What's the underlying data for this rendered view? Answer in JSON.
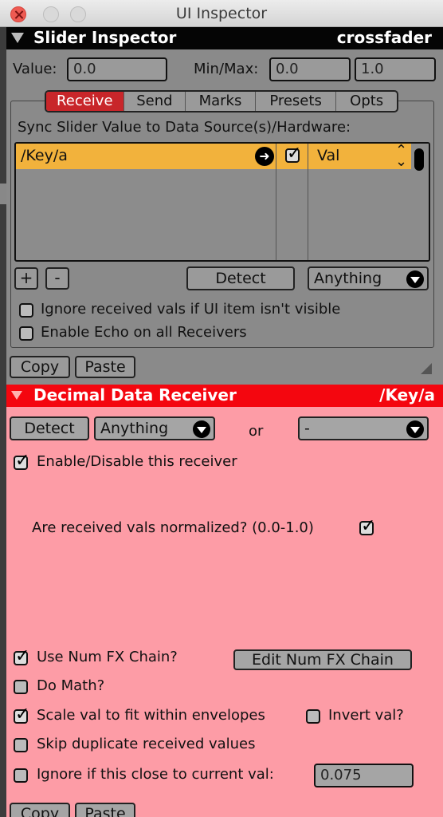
{
  "window": {
    "title": "UI Inspector"
  },
  "slider_inspector": {
    "title": "Slider Inspector",
    "item_name": "crossfader",
    "value_label": "Value:",
    "value": "0.0",
    "minmax_label": "Min/Max:",
    "min": "0.0",
    "max": "1.0",
    "tabs": [
      {
        "label": "Receive",
        "active": true
      },
      {
        "label": "Send"
      },
      {
        "label": "Marks"
      },
      {
        "label": "Presets"
      },
      {
        "label": "Opts"
      }
    ],
    "sync_label": "Sync Slider Value to Data Source(s)/Hardware:",
    "receivers": [
      {
        "address": "/Key/a",
        "enabled": true,
        "mode": "Val"
      }
    ],
    "add_label": "+",
    "remove_label": "-",
    "detect_label": "Detect",
    "type_dropdown": "Anything",
    "ignore_invisible": {
      "label": "Ignore received vals if UI item isn't visible",
      "checked": false
    },
    "enable_echo": {
      "label": "Enable Echo on all Receivers",
      "checked": false
    },
    "copy_label": "Copy",
    "paste_label": "Paste"
  },
  "decimal_receiver": {
    "title": "Decimal Data Receiver",
    "address": "/Key/a",
    "detect_label": "Detect",
    "type_dropdown": "Anything",
    "or_label": "or",
    "source_dropdown": "-",
    "enable": {
      "label": "Enable/Disable this receiver",
      "checked": true
    },
    "normalized": {
      "label": "Are received vals normalized? (0.0-1.0)",
      "checked": true
    },
    "use_fx_chain": {
      "label": "Use Num FX Chain?",
      "checked": true
    },
    "edit_fx_chain_label": "Edit Num FX Chain",
    "do_math": {
      "label": "Do Math?",
      "checked": false
    },
    "scale_val": {
      "label": "Scale val to fit within envelopes",
      "checked": true
    },
    "invert_val": {
      "label": "Invert val?",
      "checked": false
    },
    "skip_duplicates": {
      "label": "Skip duplicate received values",
      "checked": false
    },
    "ignore_close": {
      "label": "Ignore if this close to current val:",
      "checked": false,
      "value": "0.075"
    },
    "copy_label": "Copy",
    "paste_label": "Paste"
  },
  "colors": {
    "receive_tab": "#c8262a",
    "selected_row": "#f2b23c",
    "receiver_header": "#f4060f",
    "receiver_panel": "#fd9ca6"
  }
}
